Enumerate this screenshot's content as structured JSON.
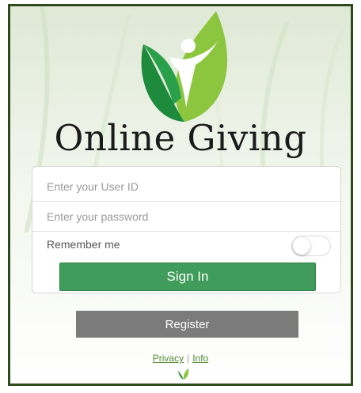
{
  "app": {
    "title": "Online Giving"
  },
  "login": {
    "user_id_placeholder": "Enter your User ID",
    "password_placeholder": "Enter your password",
    "remember_label": "Remember me",
    "remember_on": false,
    "signin_label": "Sign In"
  },
  "register_label": "Register",
  "links": {
    "privacy": "Privacy",
    "separator": "|",
    "info": "Info"
  },
  "colors": {
    "brand_green": "#3f9c5a",
    "leaf_light": "#8cc63f",
    "leaf_dark": "#1e8a3c",
    "register_gray": "#7b7b7b",
    "frame_border": "#2c4a1c"
  },
  "icons": {
    "logo": "leaf-person-logo-icon",
    "footer": "small-leaf-logo-icon"
  }
}
